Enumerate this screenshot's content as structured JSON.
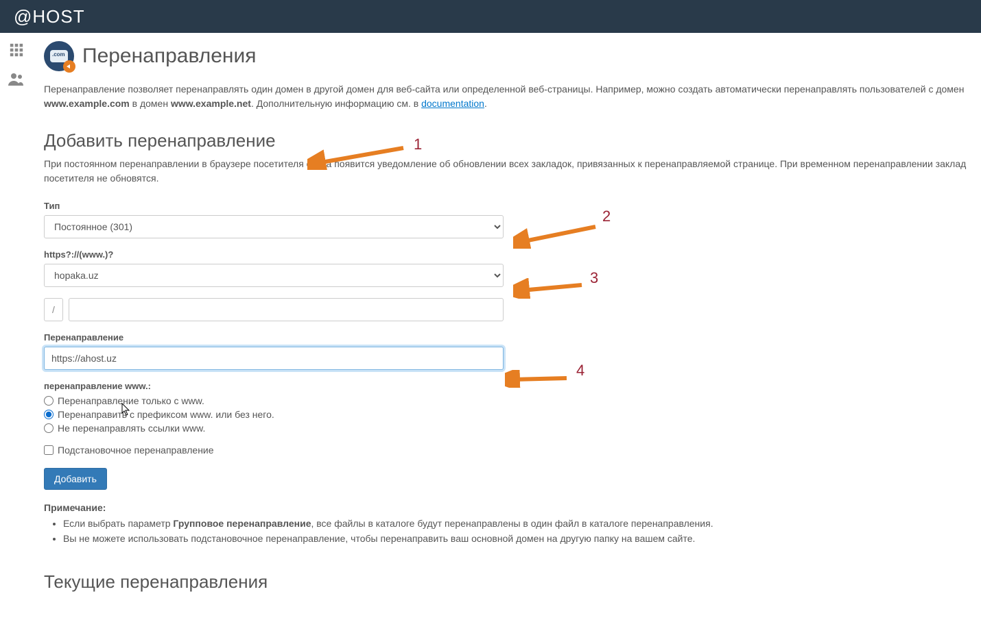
{
  "brand": "@HOST",
  "page_title": "Перенаправления",
  "intro": {
    "t1": "Перенаправление позволяет перенаправлять один домен в другой домен для веб-сайта или определенной веб-страницы. Например, можно создать автоматически перенаправлять пользователей с домен ",
    "b1": "www.example.com",
    "t2": " в домен ",
    "b2": "www.example.net",
    "t3": ". Дополнительную информацию см. в ",
    "link": "documentation",
    "t4": "."
  },
  "section_add": "Добавить перенаправление",
  "add_desc": "При постоянном перенаправлении в браузере посетителя сайта появится уведомление об обновлении всех закладок, привязанных к перенаправляемой странице. При временном перенаправлении заклад посетителя не обновятся.",
  "labels": {
    "type": "Тип",
    "https": "https?://(www.)?",
    "redirect": "Перенаправление",
    "www_heading": "перенаправление www.:",
    "path_prefix": "/"
  },
  "type_value": "Постоянное (301)",
  "domain_value": "hopaka.uz",
  "path_value": "",
  "redirect_value": "https://ahost.uz",
  "radios": {
    "r1": "Перенаправление только с www.",
    "r2": "Перенаправить с префиксом www. или без него.",
    "r3": "Не перенаправлять ссылки www."
  },
  "checkbox_label": "Подстановочное перенаправление",
  "add_button": "Добавить",
  "notes": {
    "title": "Примечание:",
    "n1a": "Если выбрать параметр ",
    "n1b": "Групповое перенаправление",
    "n1c": ", все файлы в каталоге будут перенаправлены в один файл в каталоге перенаправления.",
    "n2": "Вы не можете использовать подстановочное перенаправление, чтобы перенаправить ваш основной домен на другую папку на вашем сайте."
  },
  "section_current": "Текущие перенаправления",
  "annotations": {
    "a1": "1",
    "a2": "2",
    "a3": "3",
    "a4": "4"
  }
}
